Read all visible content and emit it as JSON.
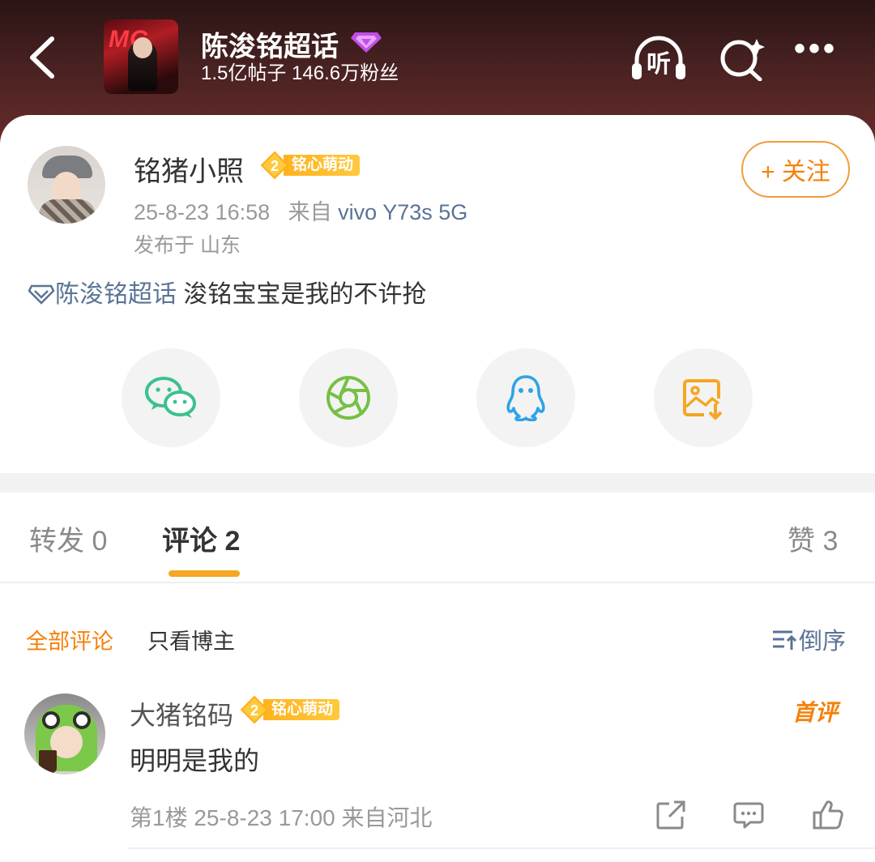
{
  "header": {
    "title": "陈浚铭超话",
    "stats": "1.5亿帖子 146.6万粉丝",
    "cover_text": "MG",
    "listen_label": "听",
    "more_label": "•••"
  },
  "post": {
    "author": "铭猪小照",
    "badge_level": "2",
    "badge_label": "铭心萌动",
    "follow_label": "+ 关注",
    "time": "25-8-23 16:58",
    "source_prefix": "来自",
    "device": "vivo Y73s 5G",
    "location": "发布于 山东",
    "topic": "陈浚铭超话",
    "text": "浚铭宝宝是我的不许抢"
  },
  "share": [
    "wechat-icon",
    "moments-icon",
    "qq-icon",
    "save-image-icon"
  ],
  "tabs": [
    {
      "label": "转发",
      "count": "0"
    },
    {
      "label": "评论",
      "count": "2"
    },
    {
      "label": "赞",
      "count": "3"
    }
  ],
  "filters": {
    "all": "全部评论",
    "author_only": "只看博主",
    "order": "倒序"
  },
  "comment": {
    "author": "大猪铭码",
    "badge_level": "2",
    "badge_label": "铭心萌动",
    "first_tag": "首评",
    "text": "明明是我的",
    "meta": "第1楼 25-8-23 17:00 来自河北"
  },
  "colors": {
    "accent_orange": "#f5810a",
    "link_blue": "#5a7396",
    "badge_gold": "#ffb21f",
    "wechat_green": "#3cc18c",
    "moments_green": "#76c043",
    "qq_blue": "#2fa3e6",
    "save_orange": "#f5a623"
  }
}
